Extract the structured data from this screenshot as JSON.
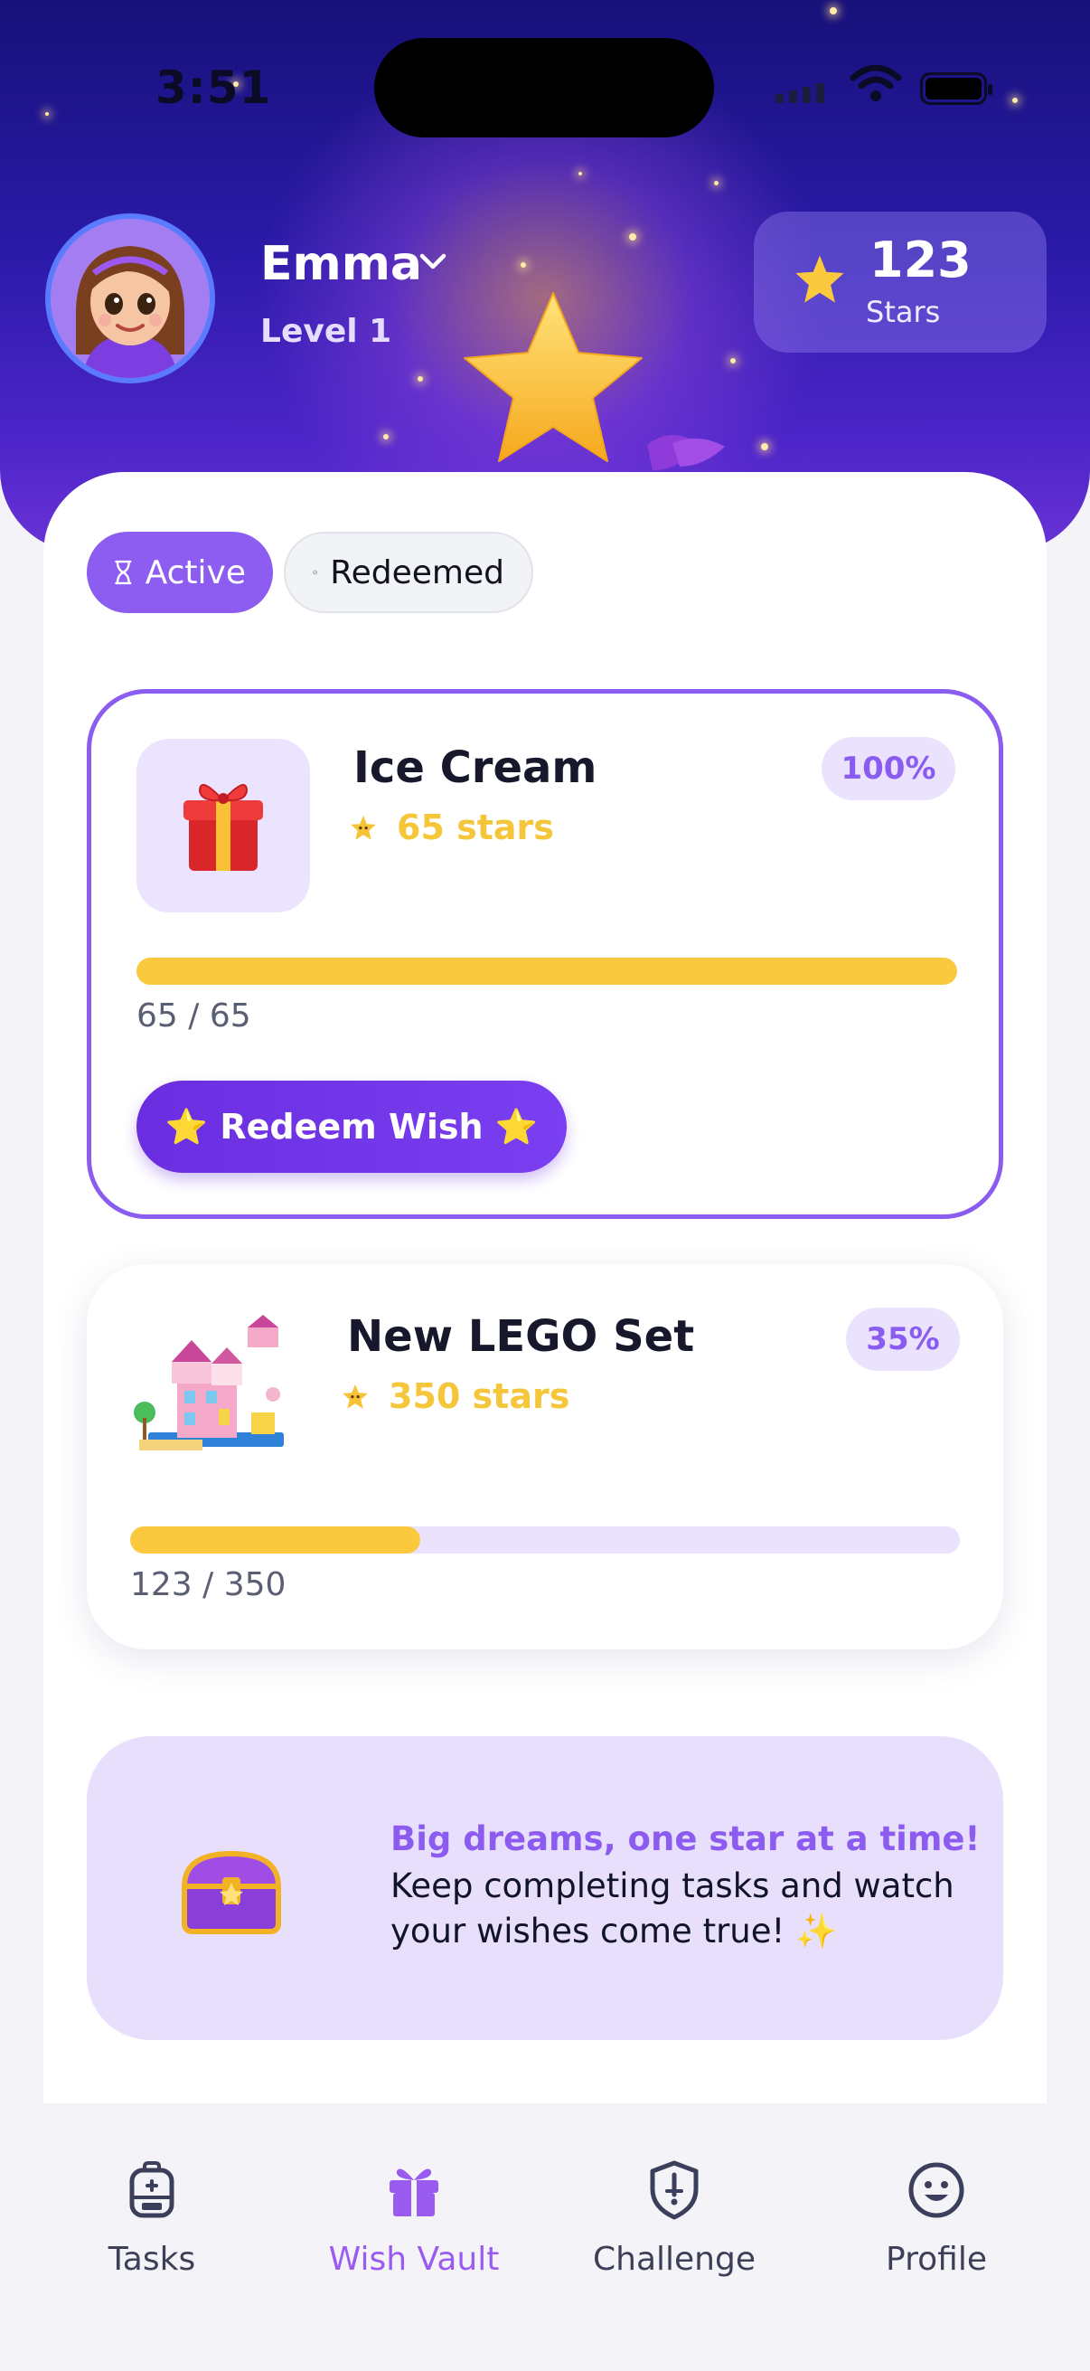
{
  "status_bar": {
    "time": "3:51"
  },
  "header": {
    "user_name": "Emma",
    "level": "Level 1",
    "stars_count": "123",
    "stars_label": "Stars"
  },
  "tabs": [
    {
      "label": "Active",
      "icon": "hourglass-icon",
      "selected": true
    },
    {
      "label": "Redeemed",
      "icon": "check-circle-icon",
      "selected": false
    }
  ],
  "wishes": [
    {
      "title": "Ice Cream",
      "cost": "65 stars",
      "percent": "100%",
      "progress_text": "65 / 65",
      "progress_fraction": 1.0,
      "button_label": "⭐ Redeem Wish ⭐",
      "icon": "gift-icon"
    },
    {
      "title": "New LEGO Set",
      "cost": "350 stars",
      "percent": "35%",
      "progress_text": "123 / 350",
      "progress_fraction": 0.35,
      "icon": "lego-set-image"
    }
  ],
  "banner": {
    "title": "Big dreams, one star at a time!",
    "line1": "Keep completing tasks and watch",
    "line2": "your wishes come true! ✨"
  },
  "nav": [
    {
      "label": "Tasks",
      "icon": "backpack-icon",
      "active": false
    },
    {
      "label": "Wish Vault",
      "icon": "gift-icon",
      "active": true
    },
    {
      "label": "Challenge",
      "icon": "shield-icon",
      "active": false
    },
    {
      "label": "Profile",
      "icon": "smiley-icon",
      "active": false
    }
  ],
  "colors": {
    "accent": "#8a5cf0",
    "star_gold": "#f5c63a",
    "progress": "#fbc93e",
    "header_dark": "#17117a"
  }
}
